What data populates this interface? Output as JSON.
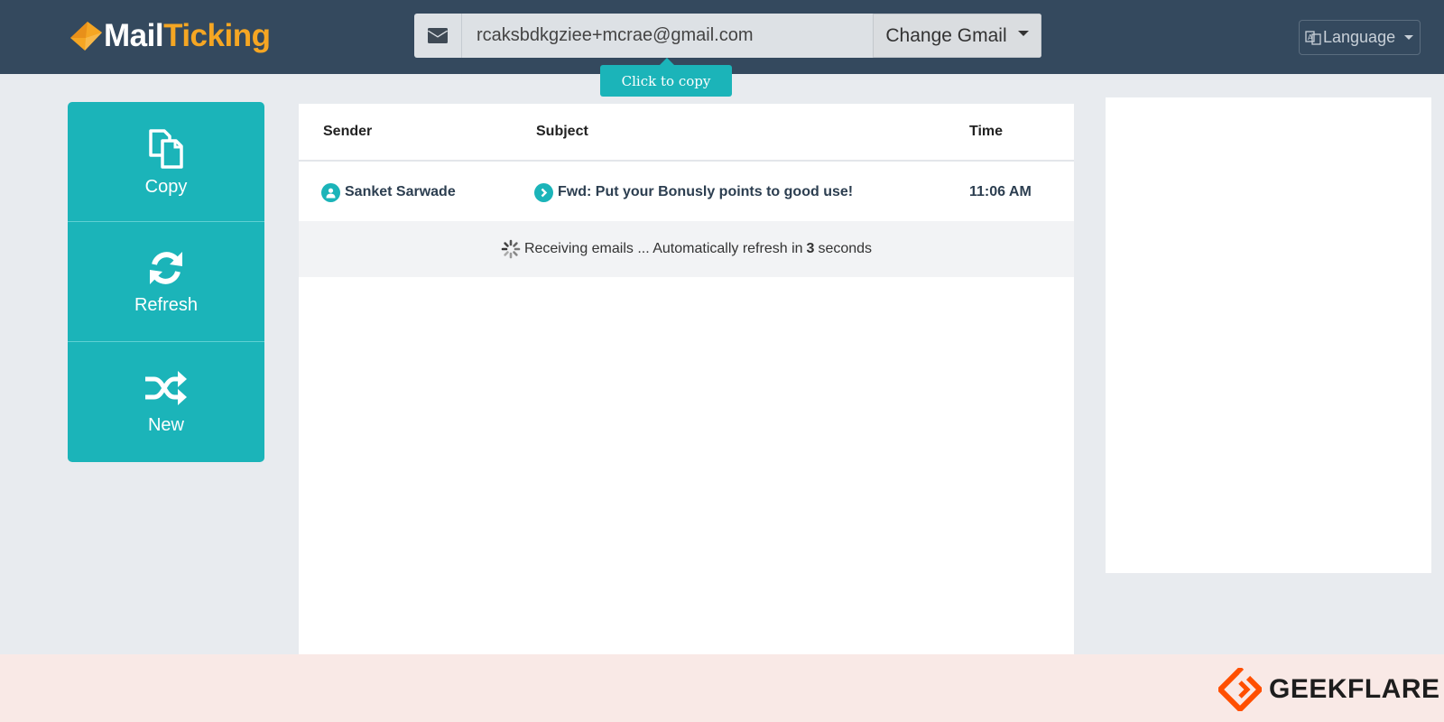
{
  "header": {
    "logo": {
      "part1": "Mail",
      "part2": "Ticking"
    },
    "email": "rcaksbdkgziee+mcrae@gmail.com",
    "change_label": "Change Gmail",
    "tooltip": "Click to copy",
    "language_label": "Language"
  },
  "actions": [
    {
      "label": "Copy",
      "icon": "copy-icon"
    },
    {
      "label": "Refresh",
      "icon": "refresh-icon"
    },
    {
      "label": "New",
      "icon": "shuffle-icon"
    }
  ],
  "table": {
    "columns": [
      "Sender",
      "Subject",
      "Time"
    ],
    "rows": [
      {
        "sender": "Sanket Sarwade",
        "subject": "Fwd: Put your Bonusly points to good use!",
        "time": "11:06 AM"
      }
    ],
    "status": {
      "prefix": "Receiving emails ... Automatically refresh in",
      "count": "3",
      "suffix": "seconds"
    }
  },
  "footer": {
    "brand": "GEEKFLARE"
  },
  "colors": {
    "accent": "#1bb4b9",
    "header_bg": "#34495e",
    "logo_orange": "#f5a623",
    "footer_bg": "#f9e9e6",
    "geekflare_orange": "#ff4f00"
  }
}
